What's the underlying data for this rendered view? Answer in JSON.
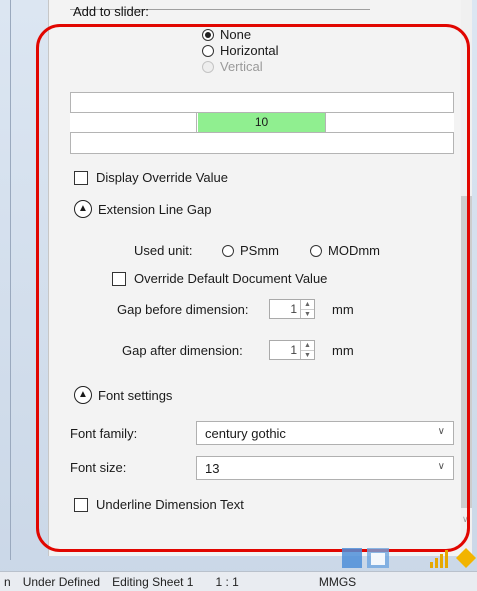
{
  "slider_section": {
    "title": "Add to slider:",
    "options": [
      "None",
      "Horizontal",
      "Vertical"
    ],
    "selected": "None"
  },
  "slider_preview": {
    "value": "10"
  },
  "display_override": {
    "label": "Display Override Value"
  },
  "extension_line_gap": {
    "title": "Extension Line Gap",
    "used_unit_label": "Used unit:",
    "unit_options": [
      "PSmm",
      "MODmm"
    ],
    "override_label": "Override Default Document Value",
    "gap_before_label": "Gap before dimension:",
    "gap_before_value": "1",
    "gap_after_label": "Gap after dimension:",
    "gap_after_value": "1",
    "unit_suffix": "mm"
  },
  "font_settings": {
    "title": "Font settings",
    "family_label": "Font family:",
    "family_value": "century gothic",
    "size_label": "Font size:",
    "size_value": "13",
    "underline_label": "Underline Dimension Text"
  },
  "status_bar": {
    "prefix": "n",
    "state": "Under Defined",
    "editing": "Editing Sheet 1",
    "scale": "1 : 1",
    "units": "MMGS"
  },
  "icons": [
    "chevron-up-icon",
    "chevron-down-icon",
    "spin-up-icon",
    "spin-down-icon",
    "signal-icon"
  ],
  "colors": {
    "highlight": "#e10600",
    "slider_value_bg": "#90ef90"
  }
}
